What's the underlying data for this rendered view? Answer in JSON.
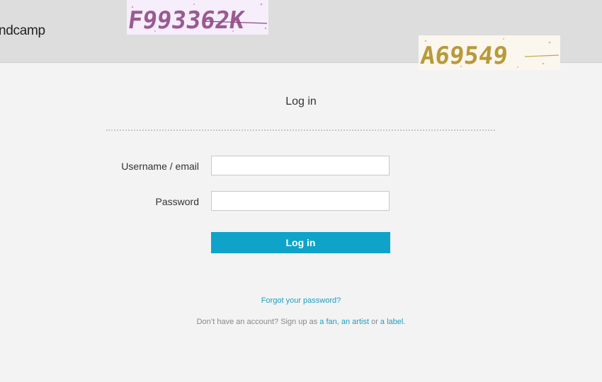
{
  "header": {
    "logo_text": "ndcamp",
    "captcha_top": {
      "text": "F993362K",
      "color": "#9a5a93",
      "bg": "#f6eefb"
    },
    "captcha_right": {
      "text": "A69549",
      "color": "#b89a3a",
      "bg": "#fbf6ee"
    }
  },
  "login": {
    "title": "Log in",
    "username_label": "Username / email",
    "username_value": "",
    "password_label": "Password",
    "password_value": "",
    "submit_label": "Log in"
  },
  "links": {
    "forgot": "Forgot your password?",
    "signup_prefix": "Don’t have an account? Sign up as",
    "fan": "a fan",
    "comma": ",",
    "artist": "an artist",
    "or": "or",
    "label": "a label",
    "period": "."
  },
  "colors": {
    "accent": "#0fa3c9",
    "link": "#1a9fc3",
    "header_bg": "#dddddd",
    "page_bg": "#f3f3f3"
  }
}
